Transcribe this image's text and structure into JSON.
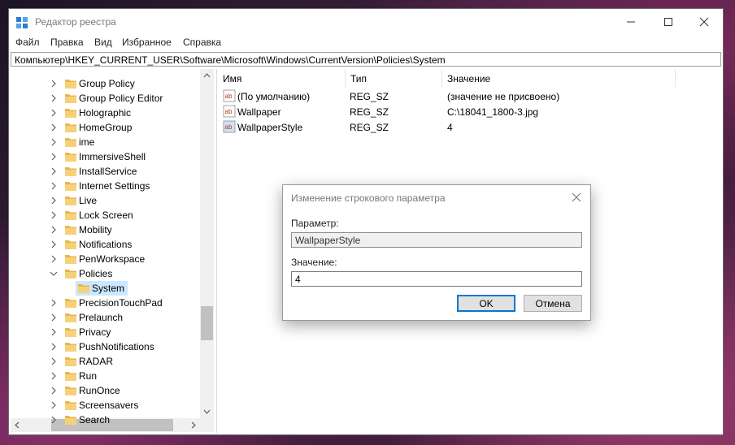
{
  "window": {
    "title": "Редактор реестра",
    "menu": [
      "Файл",
      "Правка",
      "Вид",
      "Избранное",
      "Справка"
    ],
    "address": "Компьютер\\HKEY_CURRENT_USER\\Software\\Microsoft\\Windows\\CurrentVersion\\Policies\\System"
  },
  "tree": {
    "items": [
      {
        "label": "Group Policy"
      },
      {
        "label": "Group Policy Editor"
      },
      {
        "label": "Holographic"
      },
      {
        "label": "HomeGroup"
      },
      {
        "label": "ime"
      },
      {
        "label": "ImmersiveShell"
      },
      {
        "label": "InstallService"
      },
      {
        "label": "Internet Settings"
      },
      {
        "label": "Live"
      },
      {
        "label": "Lock Screen"
      },
      {
        "label": "Mobility"
      },
      {
        "label": "Notifications"
      },
      {
        "label": "PenWorkspace"
      },
      {
        "label": "Policies"
      },
      {
        "label": "System"
      },
      {
        "label": "PrecisionTouchPad"
      },
      {
        "label": "Prelaunch"
      },
      {
        "label": "Privacy"
      },
      {
        "label": "PushNotifications"
      },
      {
        "label": "RADAR"
      },
      {
        "label": "Run"
      },
      {
        "label": "RunOnce"
      },
      {
        "label": "Screensavers"
      },
      {
        "label": "Search"
      }
    ]
  },
  "values": {
    "headers": {
      "name": "Имя",
      "type": "Тип",
      "data": "Значение"
    },
    "rows": [
      {
        "name": "(По умолчанию)",
        "type": "REG_SZ",
        "data": "(значение не присвоено)"
      },
      {
        "name": "Wallpaper",
        "type": "REG_SZ",
        "data": "C:\\18041_1800-3.jpg"
      },
      {
        "name": "WallpaperStyle",
        "type": "REG_SZ",
        "data": "4"
      }
    ]
  },
  "dialog": {
    "title": "Изменение строкового параметра",
    "param_label": "Параметр:",
    "param_value": "WallpaperStyle",
    "value_label": "Значение:",
    "value_value": "4",
    "ok": "OK",
    "cancel": "Отмена"
  },
  "colors": {
    "folder": "#e8b64c",
    "selection": "#cce8ff",
    "accent": "#0078d7"
  }
}
